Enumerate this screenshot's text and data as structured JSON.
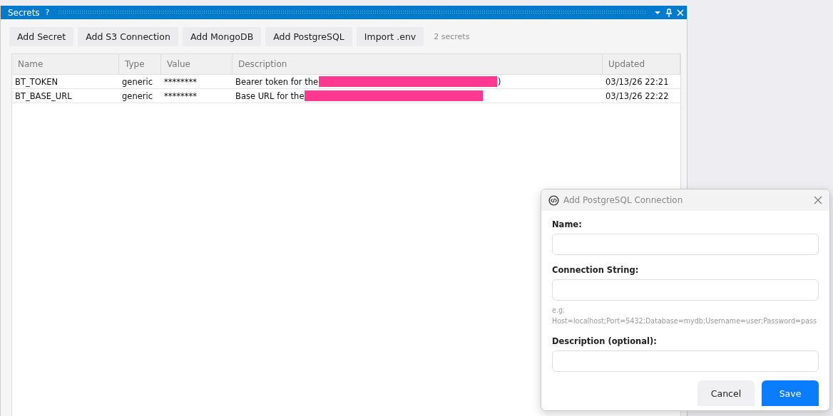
{
  "panel": {
    "title": "Secrets",
    "help": "?"
  },
  "toolbar": {
    "buttons": [
      "Add Secret",
      "Add S3 Connection",
      "Add MongoDB",
      "Add PostgreSQL",
      "Import .env"
    ],
    "count": "2 secrets"
  },
  "table": {
    "columns": [
      "Name",
      "Type",
      "Value",
      "Description",
      "Updated"
    ],
    "rows": [
      {
        "name": "BT_TOKEN",
        "type": "generic",
        "value": "********",
        "description": "Bearer token for the",
        "redacted": true,
        "description_tail": ")",
        "updated": "03/13/26 22:21"
      },
      {
        "name": "BT_BASE_URL",
        "type": "generic",
        "value": "********",
        "description": "Base URL for the",
        "redacted": true,
        "updated": "03/13/26 22:22"
      }
    ]
  },
  "dialog": {
    "title": "Add PostgreSQL Connection",
    "fields": [
      {
        "label": "Name:"
      },
      {
        "label": "Connection String:",
        "hint": "e.g. Host=localhost;Port=5432;Database=mydb;Username=user;Password=pass"
      },
      {
        "label": "Description (optional):"
      }
    ],
    "buttons": [
      {
        "label": "Cancel",
        "kind": "secondary"
      },
      {
        "label": "Save",
        "kind": "primary"
      }
    ]
  }
}
